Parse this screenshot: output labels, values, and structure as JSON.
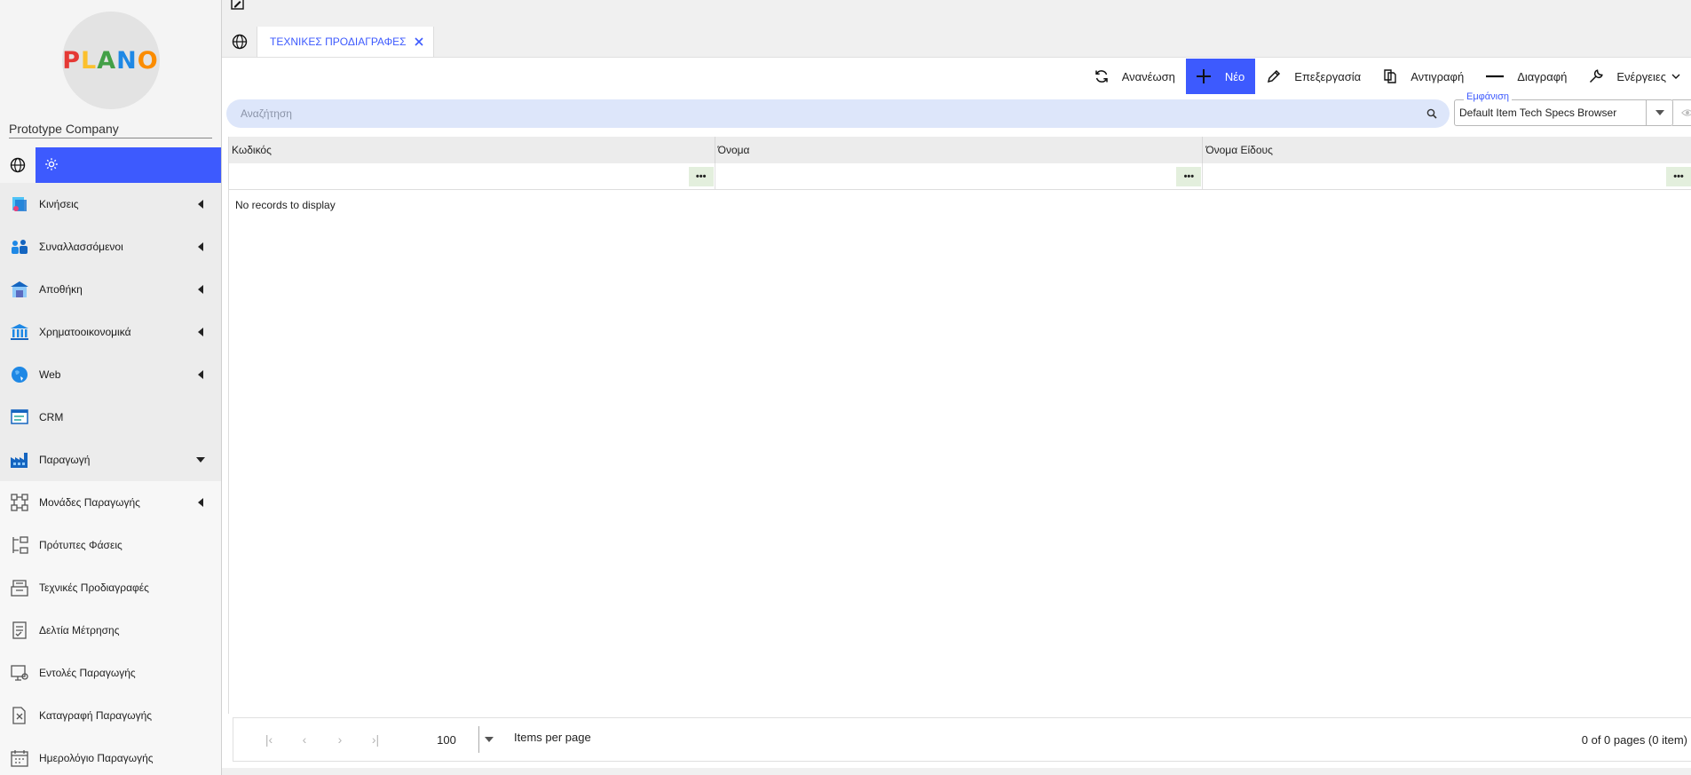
{
  "sidebar": {
    "logo_letters": [
      "P",
      "L",
      "A",
      "N",
      "O"
    ],
    "logo_colors": [
      "#e53935",
      "#fbc02d",
      "#43a047",
      "#1e88e5",
      "#fb8c00"
    ],
    "company": "Prototype Company",
    "items": [
      {
        "label": "Κινήσεις",
        "icon": "transactions-icon",
        "state": "collapsed"
      },
      {
        "label": "Συναλλασσόμενοι",
        "icon": "people-icon",
        "state": "collapsed"
      },
      {
        "label": "Αποθήκη",
        "icon": "warehouse-icon",
        "state": "collapsed"
      },
      {
        "label": "Χρηματοοικονομικά",
        "icon": "bank-icon",
        "state": "collapsed"
      },
      {
        "label": "Web",
        "icon": "globe-color-icon",
        "state": "collapsed"
      },
      {
        "label": "CRM",
        "icon": "crm-icon",
        "state": "none"
      },
      {
        "label": "Παραγωγή",
        "icon": "factory-icon",
        "state": "expanded"
      }
    ],
    "subitems": [
      {
        "label": "Μονάδες Παραγωγής",
        "icon": "units-icon",
        "state": "collapsed"
      },
      {
        "label": "Πρότυπες Φάσεις",
        "icon": "phases-icon",
        "state": "none"
      },
      {
        "label": "Τεχνικές Προδιαγραφές",
        "icon": "tech-specs-icon",
        "state": "none"
      },
      {
        "label": "Δελτία Μέτρησης",
        "icon": "measurement-icon",
        "state": "none"
      },
      {
        "label": "Εντολές Παραγωγής",
        "icon": "orders-icon",
        "state": "none"
      },
      {
        "label": "Καταγραφή Παραγωγής",
        "icon": "recording-icon",
        "state": "none"
      },
      {
        "label": "Ημερολόγιο Παραγωγής",
        "icon": "calendar-icon",
        "state": "none"
      }
    ]
  },
  "tabs": [
    {
      "label": "ΤΕΧΝΙΚΕΣ ΠΡΟΔΙΑΓΡΑΦΕΣ",
      "active": true
    }
  ],
  "toolbar": {
    "refresh": "Ανανέωση",
    "new": "Νέο",
    "edit": "Επεξεργασία",
    "copy": "Αντιγραφή",
    "delete": "Διαγραφή",
    "actions": "Ενέργειες"
  },
  "search": {
    "placeholder": "Αναζήτηση"
  },
  "appearance": {
    "label": "Εμφάνιση",
    "value": "Default Item Tech Specs Browser"
  },
  "grid": {
    "columns": [
      "Κωδικός",
      "Όνομα",
      "Όνομα Είδους"
    ],
    "filter_button": "•••",
    "empty_text": "No records to display"
  },
  "pager": {
    "page_size": "100",
    "items_per_page_label": "Items per page",
    "info": "0 of 0 pages (0 item)"
  },
  "colors": {
    "accent": "#3d5afe",
    "search_bg": "#dde6fa",
    "filter_btn_bg": "#e3efdd"
  }
}
